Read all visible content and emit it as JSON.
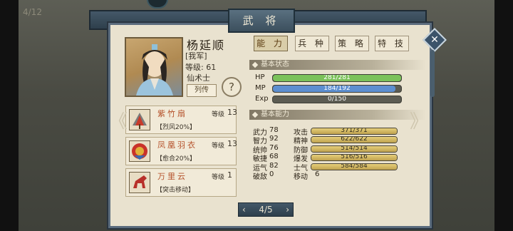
{
  "page_indicator": "4/12",
  "window_title": "武 将",
  "hero": {
    "name": "杨延顺",
    "faction": "[我军]",
    "level_label": "等级:",
    "level": "61",
    "class": "仙术士",
    "bio_button": "列传",
    "help": "?"
  },
  "tabs": [
    "能 力",
    "兵 种",
    "策 略",
    "特 技"
  ],
  "status_section": "基本状态",
  "status": [
    {
      "label": "HP",
      "text": "281/281",
      "fraction": 1.0,
      "color": "#7bc25a"
    },
    {
      "label": "MP",
      "text": "184/192",
      "fraction": 0.958,
      "color": "#5d8fd0"
    },
    {
      "label": "Exp",
      "text": "0/150",
      "fraction": 0.0,
      "color": "#d8b55a"
    }
  ],
  "ability_section": "基本能力",
  "base_attrs": [
    {
      "label": "武力",
      "value": "78"
    },
    {
      "label": "智力",
      "value": "92"
    },
    {
      "label": "统帅",
      "value": "76"
    },
    {
      "label": "敏捷",
      "value": "68"
    },
    {
      "label": "运气",
      "value": "82"
    },
    {
      "label": "破敌",
      "value": "0"
    }
  ],
  "combat_attrs": [
    {
      "label": "攻击",
      "text": "371/371",
      "fraction": 1.0
    },
    {
      "label": "精神",
      "text": "622/622",
      "fraction": 1.0
    },
    {
      "label": "防御",
      "text": "514/514",
      "fraction": 1.0
    },
    {
      "label": "爆发",
      "text": "516/516",
      "fraction": 1.0
    },
    {
      "label": "士气",
      "text": "584/584",
      "fraction": 1.0
    },
    {
      "label": "移动",
      "text": "6"
    }
  ],
  "equipment": [
    {
      "name": "紫竹扇",
      "level_label": "等级",
      "level": "13",
      "skill": "【烈风20%】"
    },
    {
      "name": "凤凰羽衣",
      "level_label": "等级",
      "level": "13",
      "skill": "【愈合20%】"
    },
    {
      "name": "万里云",
      "level_label": "等级",
      "level": "1",
      "skill": "【突击移动】"
    }
  ],
  "pager": {
    "text": "4/5",
    "prev": "‹",
    "next": "›"
  },
  "nav": {
    "left": "《",
    "right": "》"
  },
  "close_label": "✕"
}
